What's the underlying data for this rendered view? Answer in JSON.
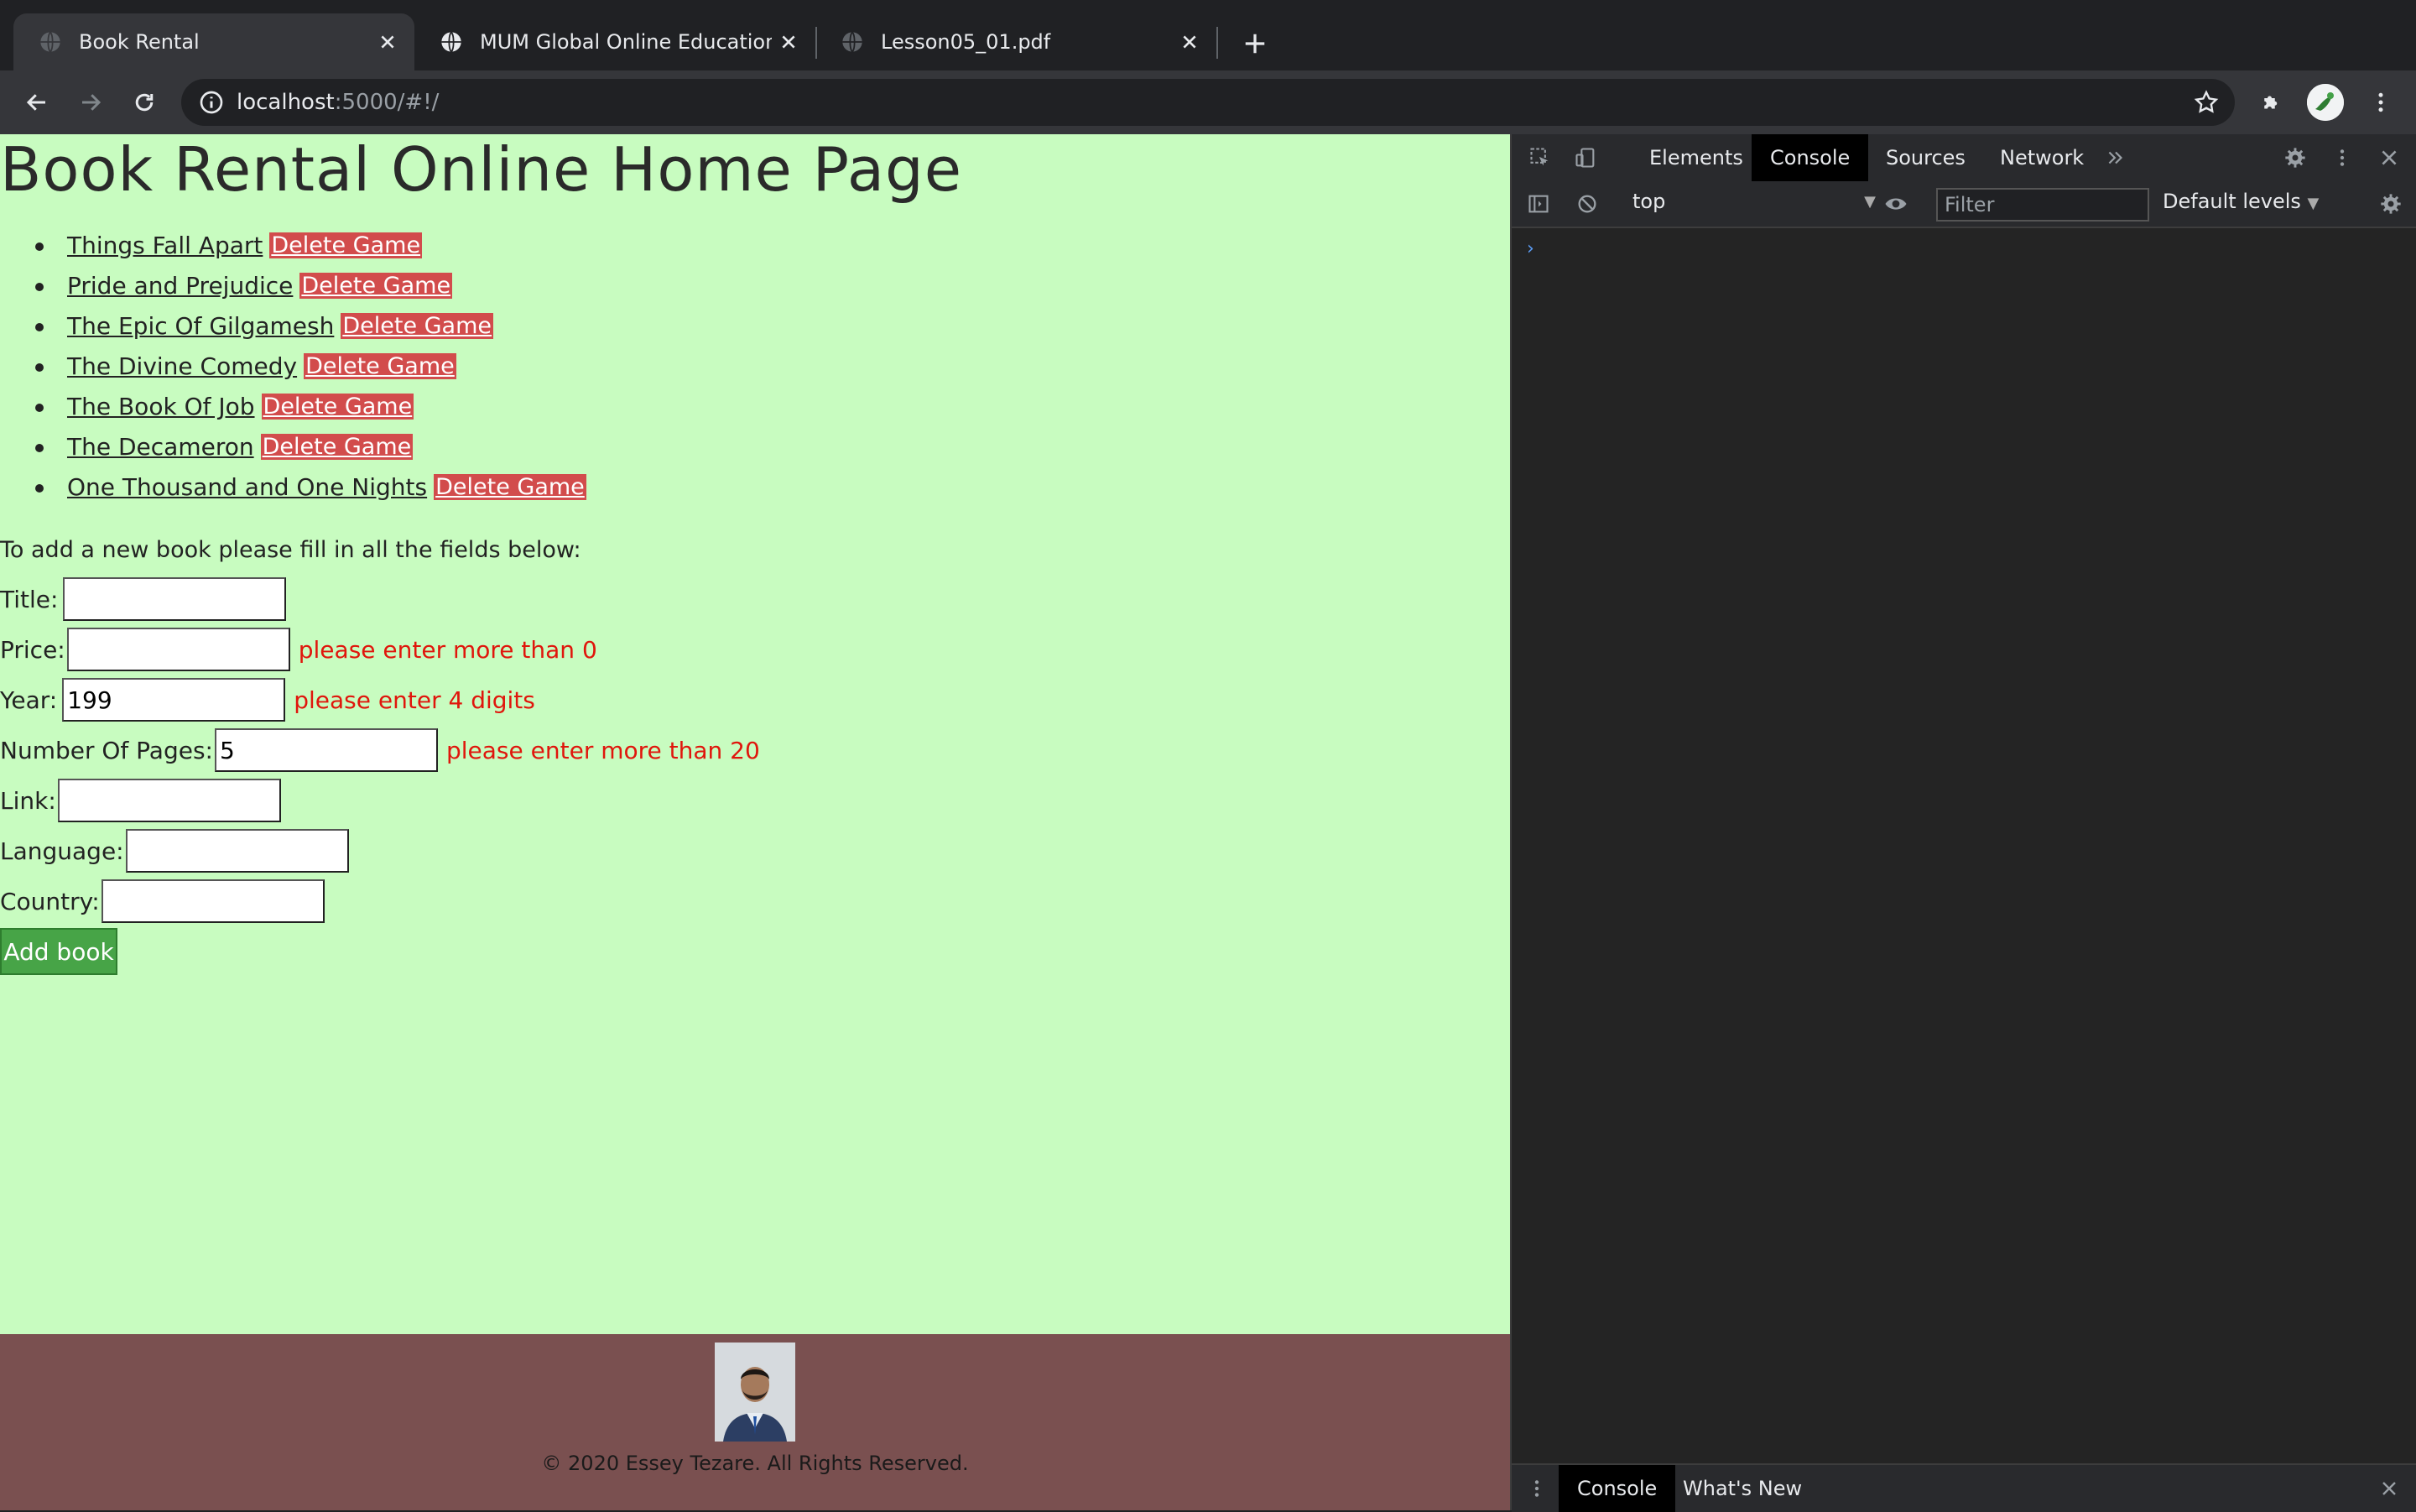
{
  "browser": {
    "tabs": [
      {
        "title": "Book Rental",
        "active": true
      },
      {
        "title": "MUM Global Online Education",
        "active": false
      },
      {
        "title": "Lesson05_01.pdf",
        "active": false
      }
    ],
    "url_host": "localhost",
    "url_path": ":5000/#!/"
  },
  "page": {
    "heading": "Book Rental Online Home Page",
    "books": [
      {
        "title": "Things Fall Apart",
        "delete_label": "Delete Game"
      },
      {
        "title": "Pride and Prejudice",
        "delete_label": "Delete Game"
      },
      {
        "title": "The Epic Of Gilgamesh",
        "delete_label": "Delete Game"
      },
      {
        "title": "The Divine Comedy",
        "delete_label": "Delete Game"
      },
      {
        "title": "The Book Of Job",
        "delete_label": "Delete Game"
      },
      {
        "title": "The Decameron",
        "delete_label": "Delete Game"
      },
      {
        "title": "One Thousand and One Nights",
        "delete_label": "Delete Game"
      }
    ],
    "form": {
      "intro": "To add a new book please fill in all the fields below:",
      "title_label": "Title:",
      "title_value": "",
      "price_label": "Price:",
      "price_value": "",
      "price_error": "please enter more than 0",
      "year_label": "Year:",
      "year_value": "199",
      "year_error": "please enter 4 digits",
      "pages_label": "Number Of Pages:",
      "pages_value": "5",
      "pages_error": "please enter more than 20",
      "link_label": "Link:",
      "link_value": "",
      "language_label": "Language:",
      "language_value": "",
      "country_label": "Country:",
      "country_value": "",
      "submit_label": "Add book"
    },
    "footer": {
      "copyright": "© 2020 Essey Tezare. All Rights Reserved."
    }
  },
  "devtools": {
    "tabs": [
      "Elements",
      "Console",
      "Sources",
      "Network"
    ],
    "active_tab": "Console",
    "context": "top",
    "filter_placeholder": "Filter",
    "levels": "Default levels",
    "prompt": "›",
    "drawer_tabs": [
      "Console",
      "What's New"
    ]
  },
  "colors": {
    "page_bg": "#c8fcc0",
    "delete_bg": "#d24c4c",
    "error_text": "#e0160c",
    "add_button": "#47a447",
    "footer_bg": "#7a5050"
  }
}
